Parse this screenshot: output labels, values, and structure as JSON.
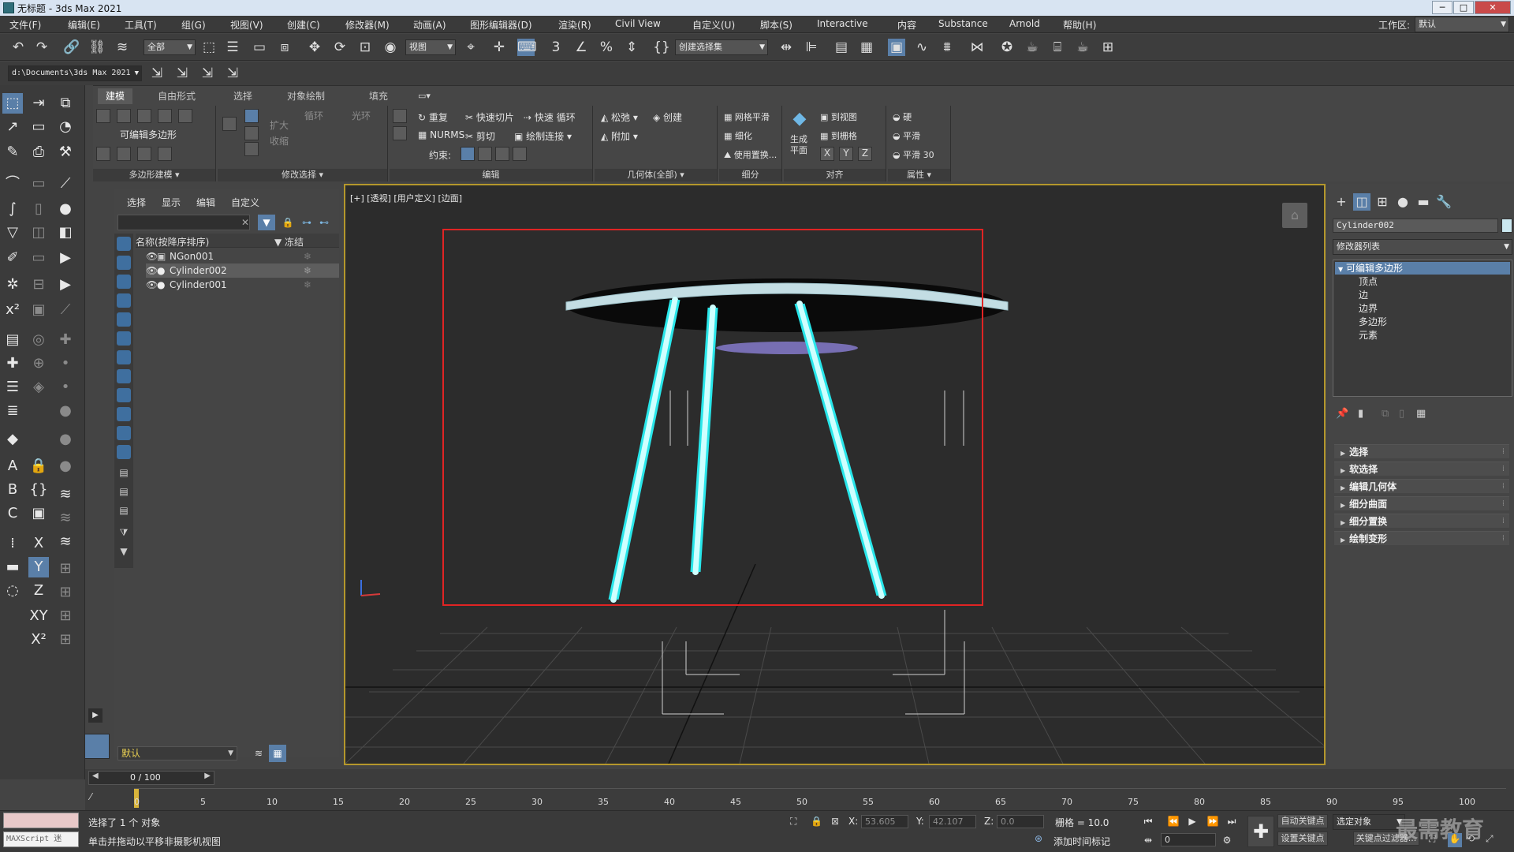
{
  "window": {
    "title": "无标题 - 3ds Max 2021",
    "controls": [
      "─",
      "□",
      "✕"
    ]
  },
  "menubar": {
    "items": [
      "文件(F)",
      "编辑(E)",
      "工具(T)",
      "组(G)",
      "视图(V)",
      "创建(C)",
      "修改器(M)",
      "动画(A)",
      "图形编辑器(D)",
      "渲染(R)",
      "Civil View",
      "自定义(U)",
      "脚本(S)",
      "Interactive",
      "内容",
      "Substance",
      "Arnold",
      "帮助(H)"
    ],
    "workspace_label": "工作区:",
    "workspace_value": "默认"
  },
  "toolbar": {
    "selection_filter": "全部",
    "ref_coord": "视图",
    "named_selection_placeholder": "创建选择集",
    "icons": [
      "undo-icon",
      "redo-icon",
      "link-icon",
      "unlink-icon",
      "bind-space-warp-icon",
      "select-object-icon",
      "select-by-name-icon",
      "rect-region-icon",
      "window-crossing-icon",
      "move-icon",
      "rotate-icon",
      "scale-icon",
      "placement-icon",
      "pivot-icon",
      "snap-3d-icon",
      "angle-snap-icon",
      "percent-snap-icon",
      "spinner-snap-icon",
      "edit-named-sel-icon",
      "mirror-icon",
      "align-icon",
      "layer-explorer-icon",
      "ribbon-toggle-icon",
      "curve-editor-icon",
      "schematic-icon",
      "material-editor-icon",
      "render-setup-icon",
      "rendered-frame-icon",
      "render-icon",
      "render-cloud-icon",
      "a360-icon"
    ]
  },
  "path": {
    "project": "d:\\Documents\\3ds Max 2021"
  },
  "ribbon": {
    "tabs": [
      "建模",
      "自由形式",
      "选择",
      "对象绘制",
      "填充"
    ],
    "active_tab": "建模",
    "panels": {
      "polygon_modeling": {
        "label": "多边形建模",
        "title": "可编辑多边形"
      },
      "modify_selection": {
        "label": "修改选择",
        "grow": "扩大",
        "shrink": "收缩",
        "loop": "循环",
        "ring": "光环"
      },
      "edit": {
        "label": "编辑",
        "repeat": "重复",
        "quickslice": "快速切片",
        "quickloop": "快速 循环",
        "nurms": "NURMS",
        "cut": "剪切",
        "paintconnect": "绘制连接",
        "constraints": "约束:"
      },
      "geometry": {
        "label": "几何体(全部)",
        "relax": "松弛",
        "create": "创建",
        "attach": "附加"
      },
      "subdivision": {
        "label": "细分",
        "meshsmooth": "网格平滑",
        "tessellate": "细化",
        "use_displacement": "使用置换..."
      },
      "align": {
        "label": "对齐",
        "make_planar": "生成\n平面",
        "to_view": "到视图",
        "to_grid": "到栅格",
        "x": "X",
        "y": "Y",
        "z": "Z"
      },
      "properties": {
        "label": "属性",
        "hard": "硬",
        "smooth": "平滑",
        "smooth30": "平滑 30"
      }
    }
  },
  "scene_explorer": {
    "menus": [
      "选择",
      "显示",
      "编辑",
      "自定义"
    ],
    "col_name": "名称(按降序排序)",
    "col_frozen": "▼ 冻结",
    "rows": [
      {
        "name": "NGon001",
        "selected": false
      },
      {
        "name": "Cylinder002",
        "selected": true
      },
      {
        "name": "Cylinder001",
        "selected": false
      }
    ],
    "layer_label": "默认"
  },
  "viewport": {
    "label": "[+] [透视] [用户定义] [边面]"
  },
  "command_panel": {
    "object_name": "Cylinder002",
    "modifier_list": "修改器列表",
    "stack": [
      {
        "label": "可编辑多边形",
        "selected": true,
        "level": 0
      },
      {
        "label": "顶点",
        "selected": false,
        "level": 1
      },
      {
        "label": "边",
        "selected": false,
        "level": 1
      },
      {
        "label": "边界",
        "selected": false,
        "level": 1
      },
      {
        "label": "多边形",
        "selected": false,
        "level": 1
      },
      {
        "label": "元素",
        "selected": false,
        "level": 1
      }
    ],
    "rollouts": [
      "选择",
      "软选择",
      "编辑几何体",
      "细分曲面",
      "细分置换",
      "绘制变形"
    ]
  },
  "timeline": {
    "frame": "0 / 100",
    "ticks": [
      "0",
      "5",
      "10",
      "15",
      "20",
      "25",
      "30",
      "35",
      "40",
      "45",
      "50",
      "55",
      "60",
      "65",
      "70",
      "75",
      "80",
      "85",
      "90",
      "95",
      "100"
    ]
  },
  "status": {
    "maxscript": "MAXScript 迷",
    "selected": "选择了 1 个 对象",
    "hint": "单击并拖动以平移非摄影机视图",
    "x_label": "X:",
    "x": "53.605",
    "y_label": "Y:",
    "y": "42.107",
    "z_label": "Z:",
    "z": "0.0",
    "grid": "栅格 = 10.0",
    "add_time_tag": "添加时间标记",
    "auto_key": "自动关键点",
    "set_key": "设置关键点",
    "selected_object": "选定对象",
    "key_filters": "关键点过滤器...",
    "frame_field": "0",
    "watermark": "最需教育"
  }
}
